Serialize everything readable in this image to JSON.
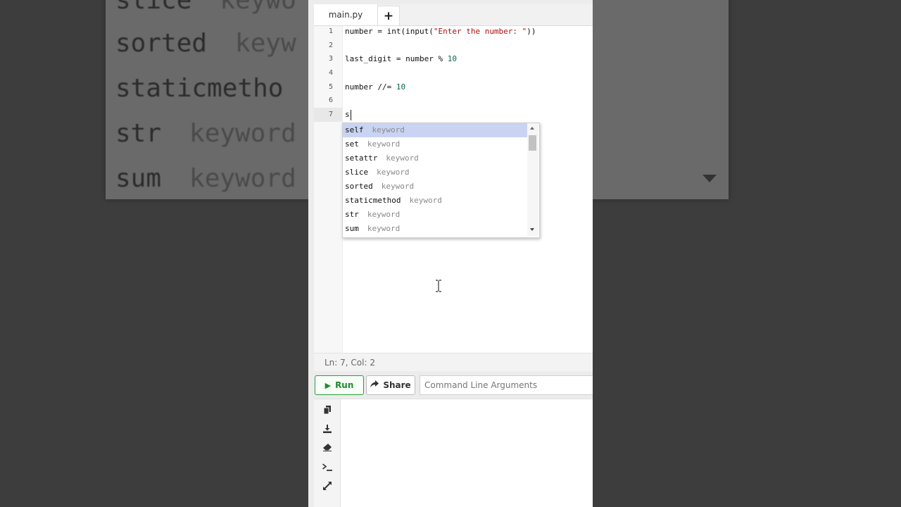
{
  "background_zoom": {
    "lines": [
      {
        "name": "slice",
        "meta": "keywo"
      },
      {
        "name": "sorted",
        "meta": "keyw"
      },
      {
        "name": "staticmetho",
        "meta": ""
      },
      {
        "name": "str",
        "meta": "keyword"
      },
      {
        "name": "sum",
        "meta": "keyword"
      }
    ]
  },
  "tabs": [
    {
      "label": "main.py",
      "active": true
    }
  ],
  "add_tab_label": "+",
  "editor": {
    "line_numbers": [
      "1",
      "2",
      "3",
      "4",
      "5",
      "6",
      "7"
    ],
    "code": {
      "l1_a": "number = int(input(",
      "l1_str": "\"Enter the number: \"",
      "l1_b": "))",
      "l3_a": "last_digit = number % ",
      "l3_num": "10",
      "l5_a": "number //= ",
      "l5_num": "10",
      "l7": "s"
    },
    "active_line": 7
  },
  "autocomplete": {
    "items": [
      {
        "label": "self",
        "meta": "keyword",
        "selected": true
      },
      {
        "label": "set",
        "meta": "keyword"
      },
      {
        "label": "setattr",
        "meta": "keyword"
      },
      {
        "label": "slice",
        "meta": "keyword"
      },
      {
        "label": "sorted",
        "meta": "keyword"
      },
      {
        "label": "staticmethod",
        "meta": "keyword"
      },
      {
        "label": "str",
        "meta": "keyword"
      },
      {
        "label": "sum",
        "meta": "keyword"
      }
    ]
  },
  "status": {
    "cursor_position": "Ln: 7,  Col: 2"
  },
  "toolbar": {
    "run_label": "Run",
    "share_label": "Share",
    "args_placeholder": "Command Line Arguments"
  },
  "console": {
    "icons": [
      "copy-icon",
      "download-icon",
      "eraser-icon",
      "terminal-icon",
      "expand-icon"
    ]
  },
  "colors": {
    "run_green": "#2a9d3a",
    "selection": "#c9d4f3",
    "string": "#aa1111",
    "number": "#116644"
  }
}
